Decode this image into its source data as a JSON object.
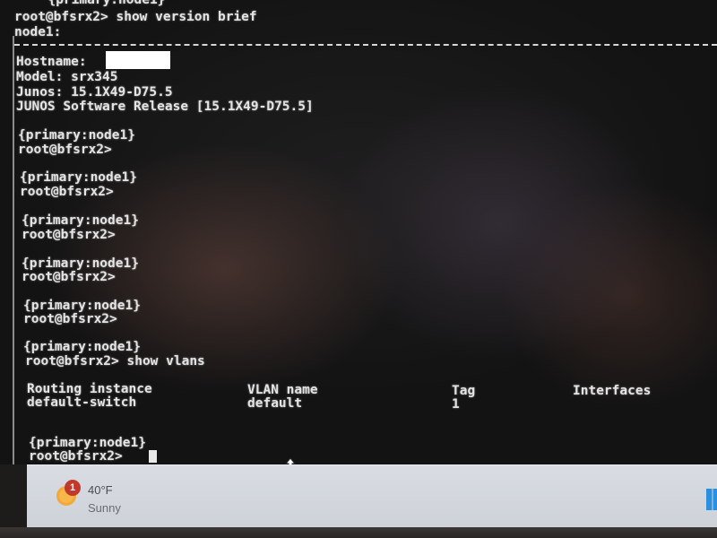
{
  "terminal": {
    "line_top_partial": "  {primary:node1}",
    "prompt_show_version": "root@bfsrx2> show version brief",
    "node_label": "node1:",
    "hostname_label": "Hostname:",
    "model": "Model: srx345",
    "junos": "Junos: 15.1X49-D75.5",
    "release": "JUNOS Software Release [15.1X49-D75.5]",
    "cluster_state": "{primary:node1}",
    "prompt": "root@bfsrx2>",
    "prompt_show_vlans": "root@bfsrx2> show vlans",
    "vlan_table": {
      "headers": [
        "Routing instance",
        "VLAN name",
        "Tag",
        "Interfaces"
      ],
      "rows": [
        [
          "default-switch",
          "default",
          "1",
          ""
        ]
      ]
    }
  },
  "taskbar": {
    "weather_badge": "1",
    "temperature": "40°F",
    "condition": "Sunny"
  }
}
